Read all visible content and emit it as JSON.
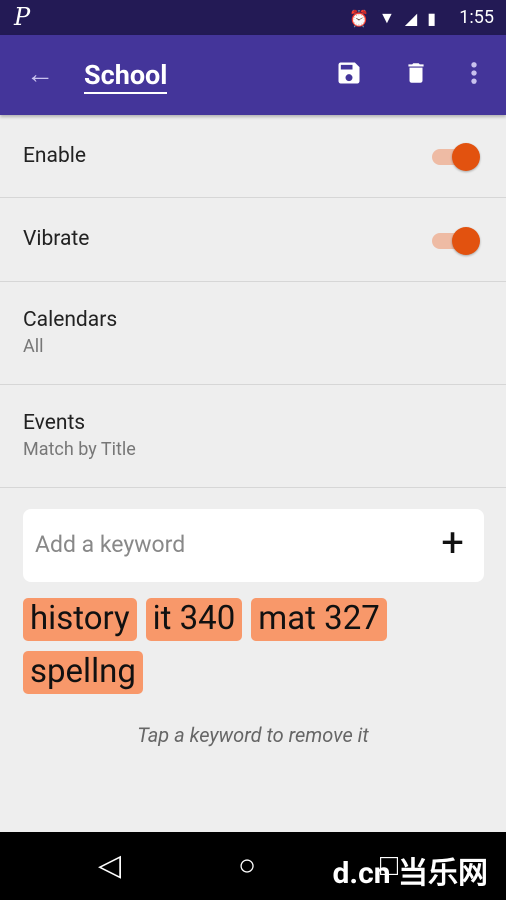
{
  "status_bar": {
    "app_icon": "P",
    "time": "1:55",
    "icons": [
      "alarm-icon",
      "wifi-icon",
      "signal-icon",
      "battery-icon"
    ]
  },
  "app_bar": {
    "title": "School",
    "actions": [
      "back-arrow-icon",
      "save-icon",
      "delete-icon",
      "more-vert-icon"
    ]
  },
  "settings": [
    {
      "label": "Enable",
      "toggle": true
    },
    {
      "label": "Vibrate",
      "toggle": true
    },
    {
      "label": "Calendars",
      "value": "All"
    },
    {
      "label": "Events",
      "value": "Match by Title"
    }
  ],
  "keyword_input": {
    "placeholder": "Add a keyword",
    "value": ""
  },
  "keywords": [
    "history",
    "it 340",
    "mat 327",
    "spellng"
  ],
  "hint": "Tap a keyword to remove it",
  "watermark": "d.cn 当乐网",
  "colors": {
    "status_bar": "#231a55",
    "app_bar": "#44359a",
    "accent": "#e2520f",
    "chip": "#f8986a"
  }
}
